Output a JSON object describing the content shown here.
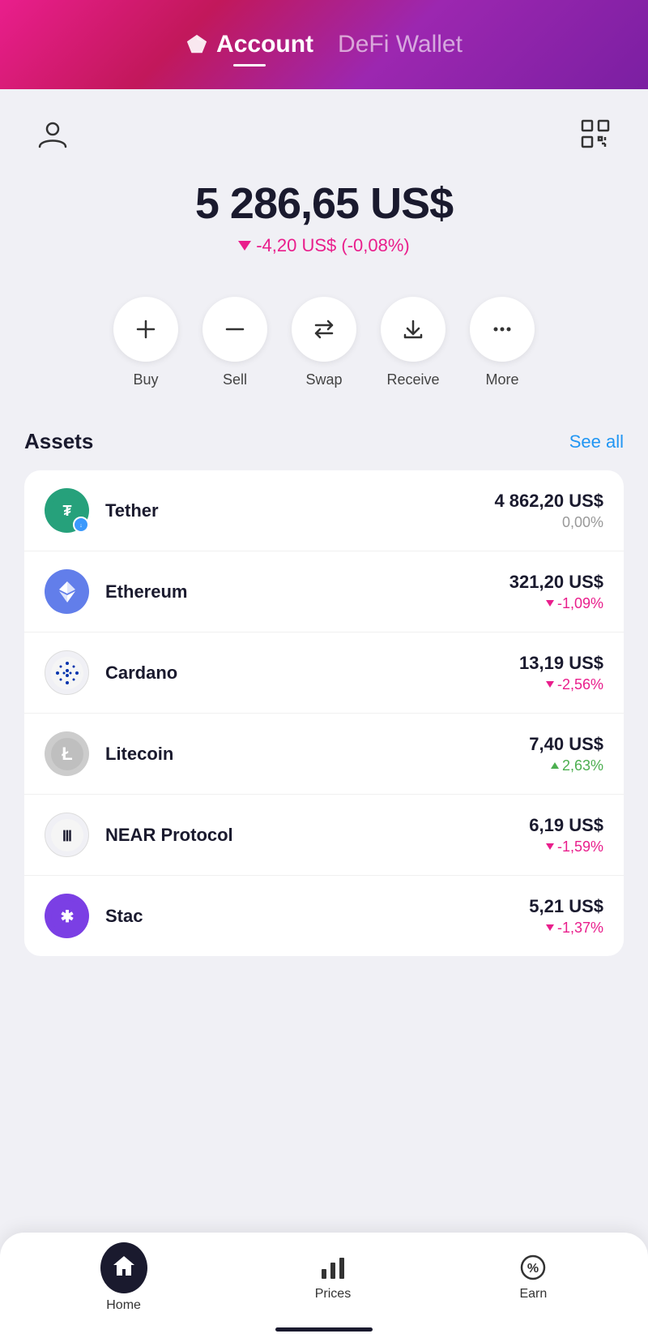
{
  "header": {
    "account_label": "Account",
    "defi_label": "DeFi Wallet"
  },
  "balance": {
    "amount": "5 286,65 US$",
    "change_text": "-4,20 US$  (-0,08%)"
  },
  "actions": [
    {
      "id": "buy",
      "label": "Buy",
      "icon": "plus"
    },
    {
      "id": "sell",
      "label": "Sell",
      "icon": "minus"
    },
    {
      "id": "swap",
      "label": "Swap",
      "icon": "swap"
    },
    {
      "id": "receive",
      "label": "Receive",
      "icon": "receive"
    },
    {
      "id": "more",
      "label": "More",
      "icon": "more"
    }
  ],
  "assets_section": {
    "title": "Assets",
    "see_all": "See all"
  },
  "assets": [
    {
      "name": "Tether",
      "amount": "4 862,20 US$",
      "change": "0,00%",
      "change_type": "neutral",
      "logo_type": "tether"
    },
    {
      "name": "Ethereum",
      "amount": "321,20 US$",
      "change": "-1,09%",
      "change_type": "negative",
      "logo_type": "ethereum"
    },
    {
      "name": "Cardano",
      "amount": "13,19 US$",
      "change": "-2,56%",
      "change_type": "negative",
      "logo_type": "cardano"
    },
    {
      "name": "Litecoin",
      "amount": "7,40 US$",
      "change": "2,63%",
      "change_type": "positive",
      "logo_type": "litecoin"
    },
    {
      "name": "NEAR Protocol",
      "amount": "6,19 US$",
      "change": "-1,59%",
      "change_type": "negative",
      "logo_type": "near"
    },
    {
      "name": "Stac",
      "amount": "5,21 US$",
      "change": "-1,37%",
      "change_type": "negative",
      "logo_type": "stacks"
    }
  ],
  "bottom_nav": [
    {
      "id": "home",
      "label": "Home",
      "active": true
    },
    {
      "id": "prices",
      "label": "Prices",
      "active": false
    },
    {
      "id": "earn",
      "label": "Earn",
      "active": false
    }
  ]
}
